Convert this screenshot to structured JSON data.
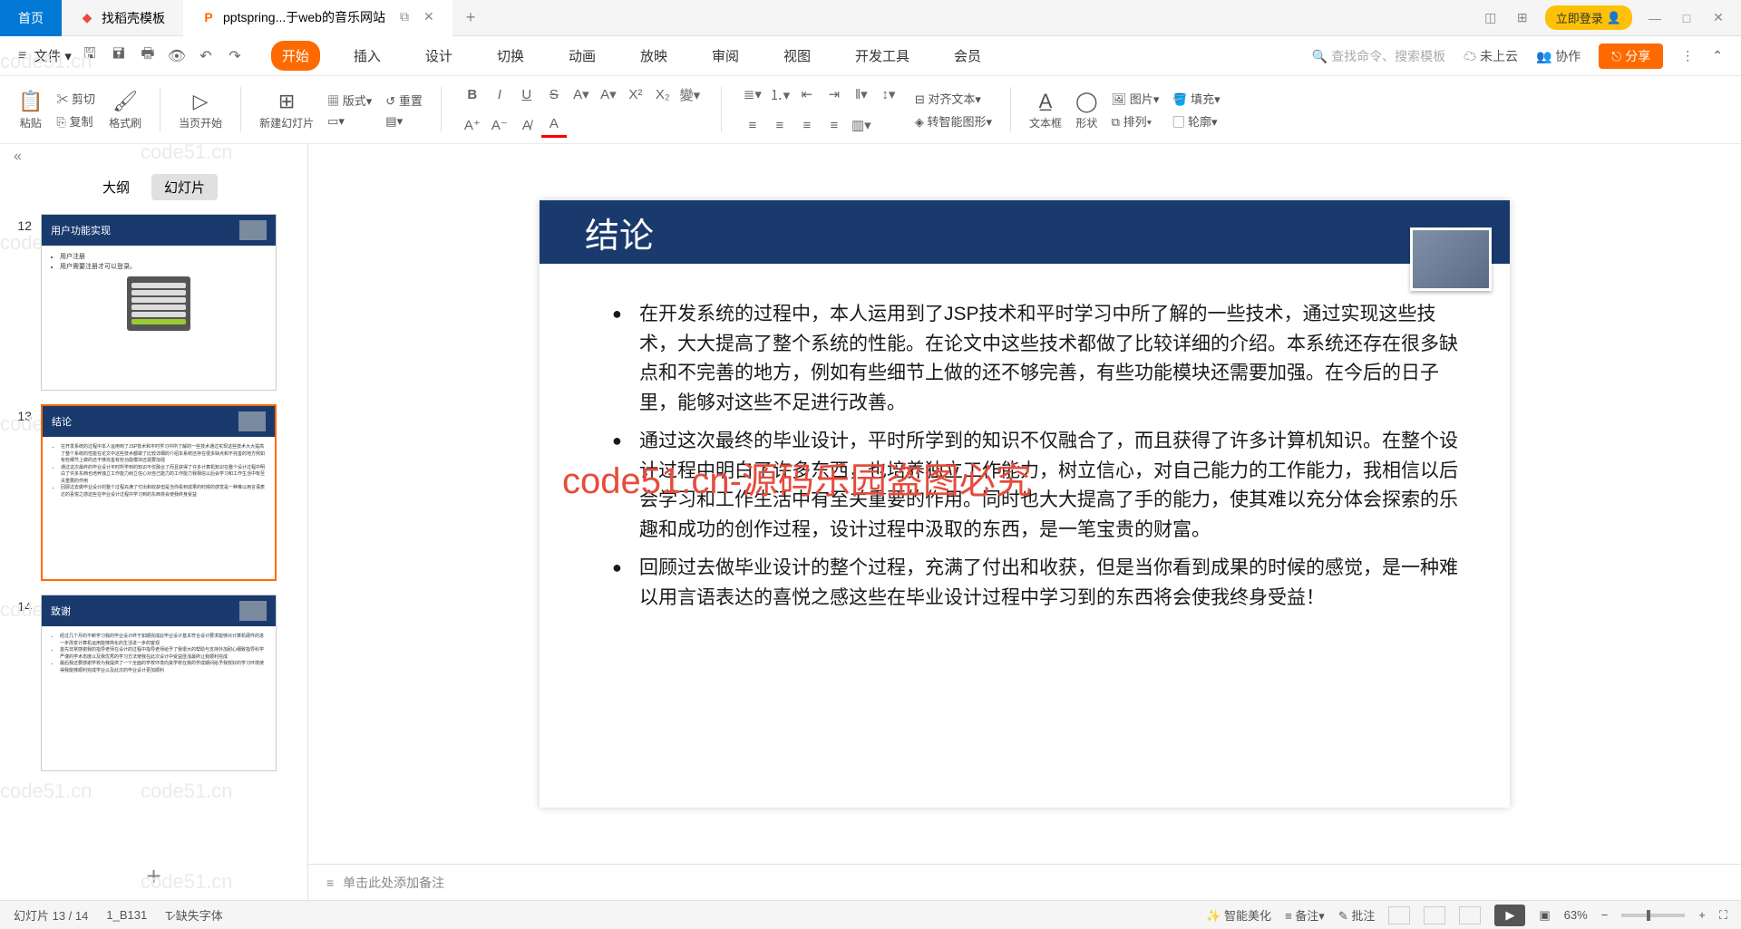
{
  "titlebar": {
    "home": "首页",
    "template": "找稻壳模板",
    "doc": "pptspring...于web的音乐网站",
    "login": "立即登录"
  },
  "menubar": {
    "file": "文件",
    "tabs": [
      "开始",
      "插入",
      "设计",
      "切换",
      "动画",
      "放映",
      "审阅",
      "视图",
      "开发工具",
      "会员"
    ],
    "search": "查找命令、搜索模板",
    "cloud": "未上云",
    "coop": "协作",
    "share": "分享"
  },
  "ribbon": {
    "paste": "粘贴",
    "cut": "剪切",
    "copy": "复制",
    "format": "格式刷",
    "curpage": "当页开始",
    "newslide": "新建幻灯片",
    "layout": "版式",
    "reset": "重置",
    "aligntext": "对齐文本",
    "smartimg": "转智能图形",
    "textbox": "文本框",
    "shape": "形状",
    "pic": "图片",
    "arrange": "排列",
    "fill": "填充",
    "outline": "轮廓"
  },
  "sidepanel": {
    "outline": "大纲",
    "slides": "幻灯片",
    "thumb12": {
      "title": "用户功能实现",
      "b1": "用户注册",
      "b2": "用户需要注册才可以登录。"
    },
    "thumb13": {
      "title": "结论"
    },
    "thumb14": {
      "title": "致谢"
    },
    "n12": "12",
    "n13": "13",
    "n14": "14"
  },
  "slide": {
    "title": "结论",
    "p1": "在开发系统的过程中，本人运用到了JSP技术和平时学习中所了解的一些技术，通过实现这些技术，大大提高了整个系统的性能。在论文中这些技术都做了比较详细的介绍。本系统还存在很多缺点和不完善的地方，例如有些细节上做的还不够完善，有些功能模块还需要加强。在今后的日子里，能够对这些不足进行改善。",
    "p2": "通过这次最终的毕业设计，平时所学到的知识不仅融合了，而且获得了许多计算机知识。在整个设计过程中明白了许多东西，也培养独立工作能力，树立信心，对自己能力的工作能力，我相信以后会学习和工作生活中有至关重要的作用。同时也大大提高了手的能力，使其难以充分体会探索的乐趣和成功的创作过程，设计过程中汲取的东西，是一笔宝贵的财富。",
    "p3": "回顾过去做毕业设计的整个过程，充满了付出和收获，但是当你看到成果的时候的感觉，是一种难以用言语表达的喜悦之感这些在毕业设计过程中学习到的东西将会使我终身受益！"
  },
  "redoverlay": "code51.cn-源码乐园盗图必究",
  "notes": "单击此处添加备注",
  "status": {
    "pos": "幻灯片 13 / 14",
    "sec": "1_B131",
    "font": "缺失字体",
    "beautify": "智能美化",
    "notes": "备注",
    "comment": "批注",
    "zoom": "63%"
  },
  "wm": "code51.cn"
}
